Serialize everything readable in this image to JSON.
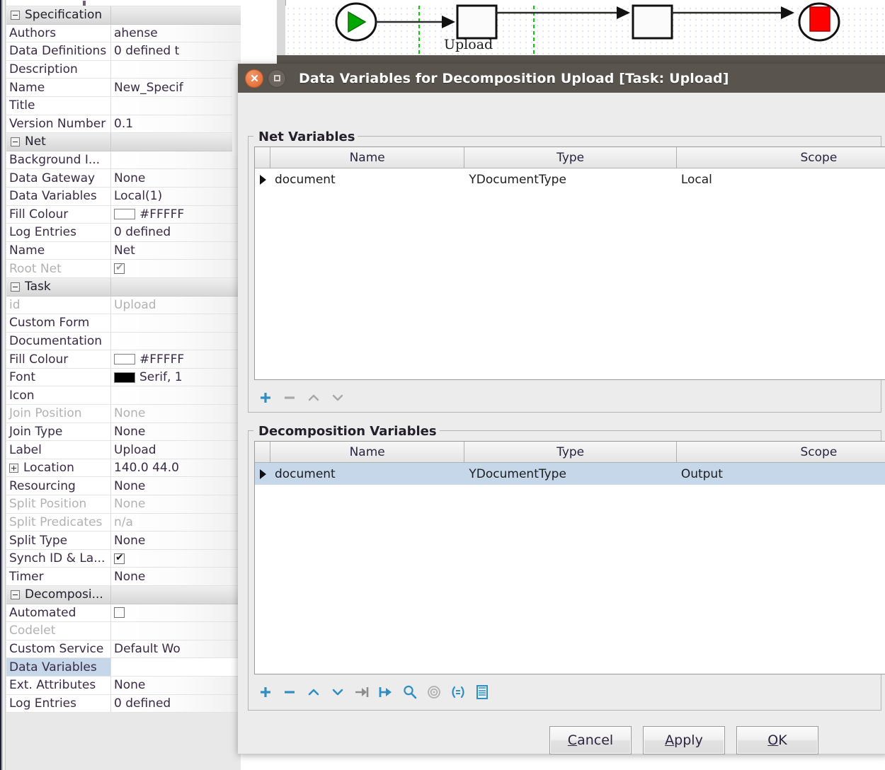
{
  "canvas": {
    "task_label": "Upload",
    "nodes": [
      "start-condition",
      "task-rectangle",
      "task-rectangle",
      "end-condition"
    ],
    "start_color": "#00a800",
    "end_color": "#ff0000"
  },
  "property_grid": {
    "rows": [
      {
        "key": "Specification",
        "value": "",
        "type": "group",
        "toggle": "minus"
      },
      {
        "key": "Authors",
        "value": "ahense",
        "type": "text"
      },
      {
        "key": "Data Definitions",
        "value": "0 defined t",
        "type": "text"
      },
      {
        "key": "Description",
        "value": "",
        "type": "text"
      },
      {
        "key": "Name",
        "value": "New_Specif",
        "type": "text"
      },
      {
        "key": "Title",
        "value": "",
        "type": "text"
      },
      {
        "key": "Version Number",
        "value": "0.1",
        "type": "text"
      },
      {
        "key": "Net",
        "value": "",
        "type": "group",
        "toggle": "minus"
      },
      {
        "key": "Background I...",
        "value": "",
        "type": "text"
      },
      {
        "key": "Data Gateway",
        "value": "None",
        "type": "text"
      },
      {
        "key": "Data Variables",
        "value": "Local(1)",
        "type": "text"
      },
      {
        "key": "Fill Colour",
        "value": "#FFFFF",
        "type": "swatch",
        "swatch": "#FFFFFF"
      },
      {
        "key": "Log Entries",
        "value": "0 defined",
        "type": "text"
      },
      {
        "key": "Name",
        "value": "Net",
        "type": "text"
      },
      {
        "key": "Root Net",
        "value": "",
        "type": "checkbox",
        "checked": true,
        "disabled": true
      },
      {
        "key": "Task",
        "value": "",
        "type": "group",
        "toggle": "minus"
      },
      {
        "key": "id",
        "value": "Upload",
        "type": "text",
        "disabled": true
      },
      {
        "key": "Custom Form",
        "value": "",
        "type": "text"
      },
      {
        "key": "Documentation",
        "value": "",
        "type": "text"
      },
      {
        "key": "Fill Colour",
        "value": "#FFFFF",
        "type": "swatch",
        "swatch": "#FFFFFF"
      },
      {
        "key": "Font",
        "value": "Serif, 1",
        "type": "swatch",
        "swatch": "#000000"
      },
      {
        "key": "Icon",
        "value": "",
        "type": "text"
      },
      {
        "key": "Join Position",
        "value": "None",
        "type": "text",
        "disabled": true
      },
      {
        "key": "Join Type",
        "value": "None",
        "type": "text"
      },
      {
        "key": "Label",
        "value": "Upload",
        "type": "text"
      },
      {
        "key": "Location",
        "value": "140.0 44.0",
        "type": "group-sub",
        "toggle": "plus"
      },
      {
        "key": "Resourcing",
        "value": "None",
        "type": "text"
      },
      {
        "key": "Split Position",
        "value": "None",
        "type": "text",
        "disabled": true
      },
      {
        "key": "Split Predicates",
        "value": "n/a",
        "type": "text",
        "disabled": true
      },
      {
        "key": "Split Type",
        "value": "None",
        "type": "text"
      },
      {
        "key": "Synch ID & La...",
        "value": "",
        "type": "checkbox",
        "checked": true
      },
      {
        "key": "Timer",
        "value": "None",
        "type": "text"
      },
      {
        "key": "Decomposi...",
        "value": "",
        "type": "group",
        "toggle": "minus"
      },
      {
        "key": "Automated",
        "value": "",
        "type": "checkbox",
        "checked": false
      },
      {
        "key": "Codelet",
        "value": "",
        "type": "text",
        "disabled": true
      },
      {
        "key": "Custom Service",
        "value": "Default Wo",
        "type": "text"
      },
      {
        "key": "Data Variables",
        "value": "",
        "type": "text",
        "selected": true
      },
      {
        "key": "Ext. Attributes",
        "value": "None",
        "type": "text"
      },
      {
        "key": "Log Entries",
        "value": "0 defined",
        "type": "text"
      }
    ]
  },
  "dialog": {
    "title": "Data Variables for  Decomposition Upload [Task: Upload]",
    "window_buttons": [
      {
        "name": "close-icon",
        "label": "Close"
      },
      {
        "name": "maximize-icon",
        "label": "Maximize"
      }
    ],
    "net_variables": {
      "title": "Net Variables",
      "columns": [
        "",
        "Name",
        "Type",
        "Scope"
      ],
      "rows": [
        {
          "marker": true,
          "name": "document",
          "type": "YDocumentType",
          "scope": "Local",
          "selected": false
        }
      ],
      "toolbar": [
        {
          "name": "add-variable-button",
          "icon": "plus",
          "enabled": true
        },
        {
          "name": "remove-variable-button",
          "icon": "minus",
          "enabled": false
        },
        {
          "name": "move-up-button",
          "icon": "chevron-up",
          "enabled": false
        },
        {
          "name": "move-down-button",
          "icon": "chevron-down",
          "enabled": false
        }
      ]
    },
    "decomposition_variables": {
      "title": "Decomposition Variables",
      "columns": [
        "",
        "Name",
        "Type",
        "Scope"
      ],
      "rows": [
        {
          "marker": true,
          "name": "document",
          "type": "YDocumentType",
          "scope": "Output",
          "selected": true
        }
      ],
      "toolbar": [
        {
          "name": "add-variable-button",
          "icon": "plus",
          "enabled": true
        },
        {
          "name": "remove-variable-button",
          "icon": "minus",
          "enabled": true
        },
        {
          "name": "move-up-button",
          "icon": "chevron-up",
          "enabled": true
        },
        {
          "name": "move-down-button",
          "icon": "chevron-down",
          "enabled": true
        },
        {
          "name": "input-mapping-button",
          "icon": "arrow-to-bar",
          "enabled": true
        },
        {
          "name": "output-mapping-button",
          "icon": "bar-to-arrow",
          "enabled": true
        },
        {
          "name": "inspect-button",
          "icon": "magnifier",
          "enabled": true
        },
        {
          "name": "target-button",
          "icon": "target",
          "enabled": false
        },
        {
          "name": "xquery-button",
          "icon": "angle-brackets",
          "enabled": true
        },
        {
          "name": "log-predicate-button",
          "icon": "document-lines",
          "enabled": true
        }
      ]
    },
    "buttons": [
      {
        "name": "cancel-button",
        "label": "Cancel",
        "mnemonic": "C"
      },
      {
        "name": "apply-button",
        "label": "Apply",
        "mnemonic": "A"
      },
      {
        "name": "ok-button",
        "label": "OK",
        "mnemonic": "O"
      }
    ]
  },
  "colors": {
    "titlebar_bg": "#5a544e",
    "selection_blue": "#c6d7ea",
    "icon_blue": "#2f8fc0",
    "icon_disabled": "#a8a8a8",
    "close_orange": "#e0622d"
  }
}
